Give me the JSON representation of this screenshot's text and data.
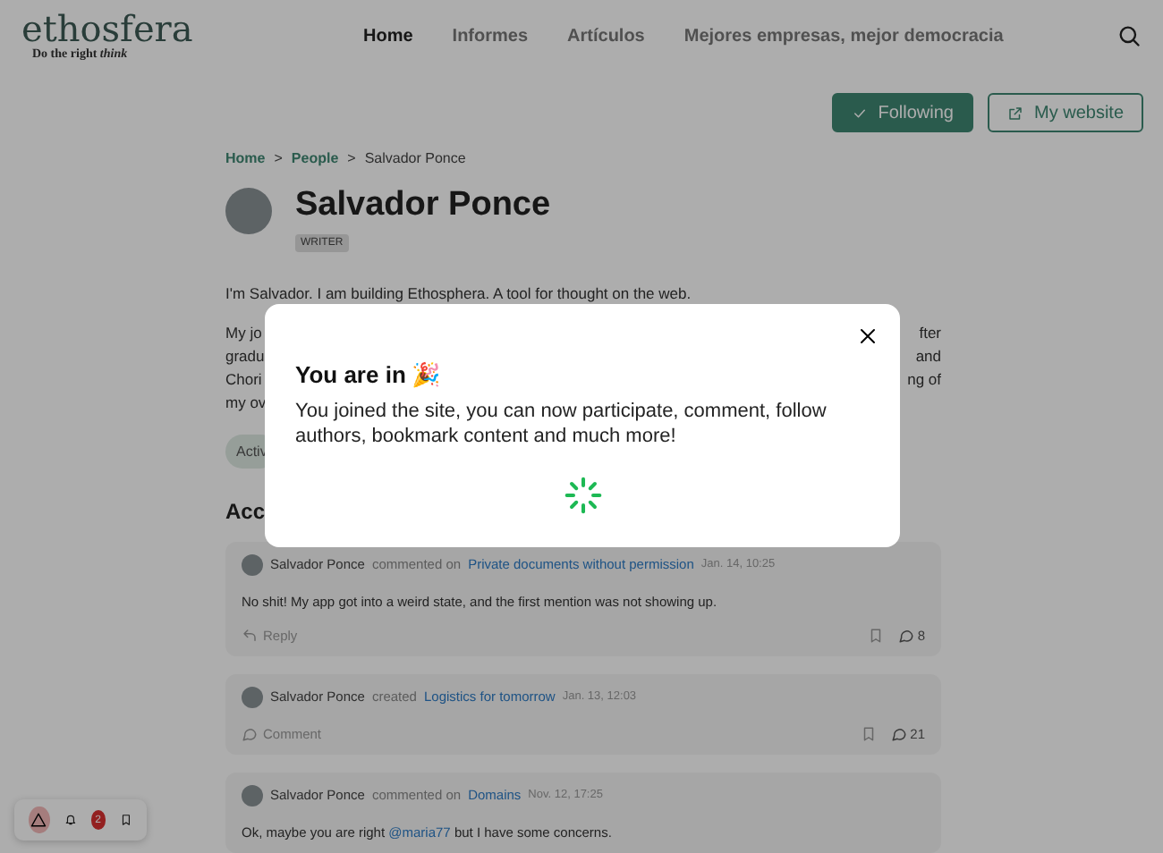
{
  "header": {
    "logo": "ethosfera",
    "tagline": "Do the right",
    "tagline_italic": "think",
    "nav": [
      {
        "label": "Home",
        "selected": true
      },
      {
        "label": "Informes",
        "selected": false
      },
      {
        "label": "Artículos",
        "selected": false
      },
      {
        "label": "Mejores empresas, mejor democracia",
        "selected": false
      }
    ]
  },
  "actions": [
    {
      "kind": "primary",
      "label": "Following"
    },
    {
      "kind": "secondary",
      "label": "My website"
    }
  ],
  "breadcrumb": {
    "links": [
      "Home",
      "People"
    ],
    "separator": ">",
    "current": "Salvador Ponce"
  },
  "profile": {
    "name": "Salvador Ponce",
    "role": "WRITER"
  },
  "bio": {
    "intro": "I'm Salvador. I am building Ethosphera. A tool for thought on the web.",
    "lines": [
      {
        "left": "My jo",
        "right": "fter"
      },
      {
        "left": "gradu",
        "right": "and"
      },
      {
        "left": "Chori",
        "right": "ng of"
      },
      {
        "left": "my ov"
      }
    ]
  },
  "tab_pill": "Activ",
  "section_title": "Acc",
  "activity": [
    {
      "author": "Salvador Ponce",
      "verb": "commented on",
      "target": "Private documents without permission",
      "date": "Jan. 14, 10:25",
      "text": "No shit! My app got into a weird state, and the first mention was not showing up.",
      "action": "Reply",
      "kind": "reply",
      "count": "8"
    },
    {
      "author": "Salvador Ponce",
      "verb": "created",
      "target": "Logistics for tomorrow",
      "date": "Jan. 13, 12:03",
      "action": "Comment",
      "kind": "comment",
      "count": "21"
    },
    {
      "author": "Salvador Ponce",
      "verb": "commented on",
      "target": "Domains",
      "date": "Nov. 12, 17:25",
      "text_before": "Ok, maybe you are right",
      "mention": "@maria77",
      "text_after": "but I have some concerns."
    }
  ],
  "floating_bar": {
    "badge": "2"
  },
  "modal": {
    "title": "You are in",
    "emoji": "🎉",
    "body": "You joined the site, you can now participate, comment, follow authors, bookmark content and much more!"
  }
}
